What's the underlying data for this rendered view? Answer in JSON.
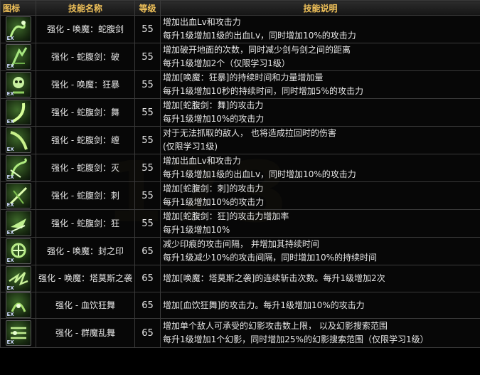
{
  "watermark": "173",
  "headers": {
    "icon": "图标",
    "name": "技能名称",
    "level": "等级",
    "desc": "技能说明"
  },
  "icon_badge": "EX",
  "skills": [
    {
      "icon": "serpent-sword-summon-icon",
      "name": "强化 - 唤魔：蛇腹剑",
      "level": "55",
      "desc": [
        "增加出血Lv和攻击力",
        "每升1级增加1级的出血Lv，同时增加10%的攻击力"
      ]
    },
    {
      "icon": "serpent-sword-break-icon",
      "name": "强化 - 蛇腹剑：破",
      "level": "55",
      "desc": [
        "增加破开地面的次数，同时减少剑与剑之间的距离",
        "每升1级增加2个（仅限学习1级）"
      ]
    },
    {
      "icon": "rampage-icon",
      "name": "强化 - 唤魔：狂暴",
      "level": "55",
      "desc": [
        "增加[唤魔：狂暴]的持续时间和力量增加量",
        "每升1级增加10秒的持续时间，同时增加5%的攻击力"
      ]
    },
    {
      "icon": "serpent-sword-dance-icon",
      "name": "强化 - 蛇腹剑：舞",
      "level": "55",
      "desc": [
        "增加[蛇腹剑：舞]的攻击力",
        "每升1级增加10%的攻击力"
      ]
    },
    {
      "icon": "serpent-sword-bind-icon",
      "name": "强化 - 蛇腹剑：缠",
      "level": "55",
      "desc": [
        "对于无法抓取的敌人， 也将造成拉回时的伤害",
        "(仅限学习1级)"
      ]
    },
    {
      "icon": "serpent-sword-destroy-icon",
      "name": "强化 - 蛇腹剑：灭",
      "level": "55",
      "desc": [
        "增加出血Lv和攻击力",
        "每升1级增加1级的出血Lv，同时增加10%的攻击力"
      ]
    },
    {
      "icon": "serpent-sword-pierce-icon",
      "name": "强化 - 蛇腹剑：刺",
      "level": "55",
      "desc": [
        "增加[蛇腹剑：刺]的攻击力",
        "每升1级增加10%的攻击力"
      ]
    },
    {
      "icon": "serpent-sword-frenzy-icon",
      "name": "强化 - 蛇腹剑：狂",
      "level": "55",
      "desc": [
        "增加[蛇腹剑：狂]的攻击力增加率",
        "每升1级增加10%"
      ]
    },
    {
      "icon": "sealing-seal-icon",
      "name": "强化 - 唤魔：封之印",
      "level": "65",
      "desc": [
        "减少印痕的攻击间隔， 并增加其持续时间",
        "每升1级减少10%的攻击间隔，同时增加10%的持续时间"
      ]
    },
    {
      "icon": "tamos-raid-icon",
      "name": "强化 - 唤魔：塔莫斯之袭",
      "level": "65",
      "desc": [
        "增加[唤魔：塔莫斯之袭]的连续斩击次数。每升1级增加2次"
      ]
    },
    {
      "icon": "blood-frenzy-dance-icon",
      "name": "强化 - 血饮狂舞",
      "level": "65",
      "desc": [
        "增加[血饮狂舞]的攻击力。每升1级增加10%的攻击力"
      ]
    },
    {
      "icon": "demon-swarm-dance-icon",
      "name": "强化 - 群魔乱舞",
      "level": "65",
      "desc": [
        "增加单个敌人可承受的幻影攻击数上限， 以及幻影搜索范围",
        "每升1级增加1个幻影，同时增加25%的幻影搜索范围（仅限学习1级）"
      ]
    }
  ]
}
